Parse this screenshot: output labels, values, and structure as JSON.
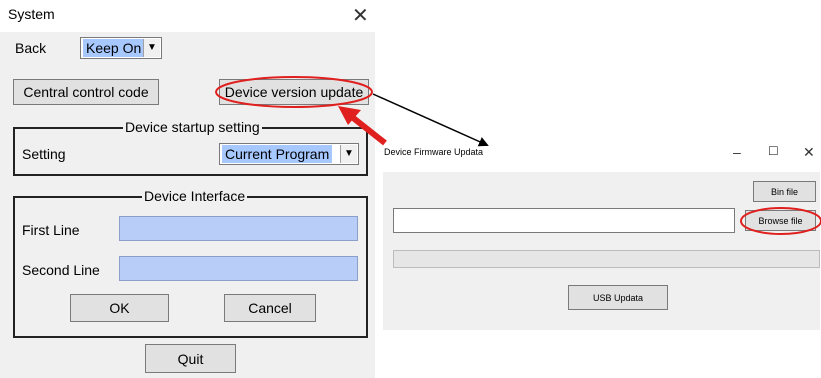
{
  "system_dialog": {
    "title": "System",
    "close_glyph": "✕",
    "back_label": "Back",
    "back_value": "Keep On",
    "central_control_button": "Central control code",
    "device_version_update_button": "Device version update",
    "startup_group_title": "Device startup setting",
    "setting_label": "Setting",
    "setting_value": "Current Program",
    "interface_group_title": "Device Interface",
    "first_line_label": "First Line",
    "first_line_value": "",
    "second_line_label": "Second Line",
    "second_line_value": "",
    "ok_button": "OK",
    "cancel_button": "Cancel",
    "quit_button": "Quit"
  },
  "firmware_dialog": {
    "title": "Device Firmware Updata",
    "minimize_glyph": "–",
    "maximize_glyph": "☐",
    "close_glyph": "✕",
    "bin_file_button": "Bin file",
    "file_path_value": "",
    "browse_file_button": "Browse file",
    "progress": 0,
    "usb_update_button": "USB Updata"
  },
  "annotations": {
    "highlight_color": "#e0201e",
    "arrow_color": "#e0201e",
    "connector_color": "#000000"
  }
}
